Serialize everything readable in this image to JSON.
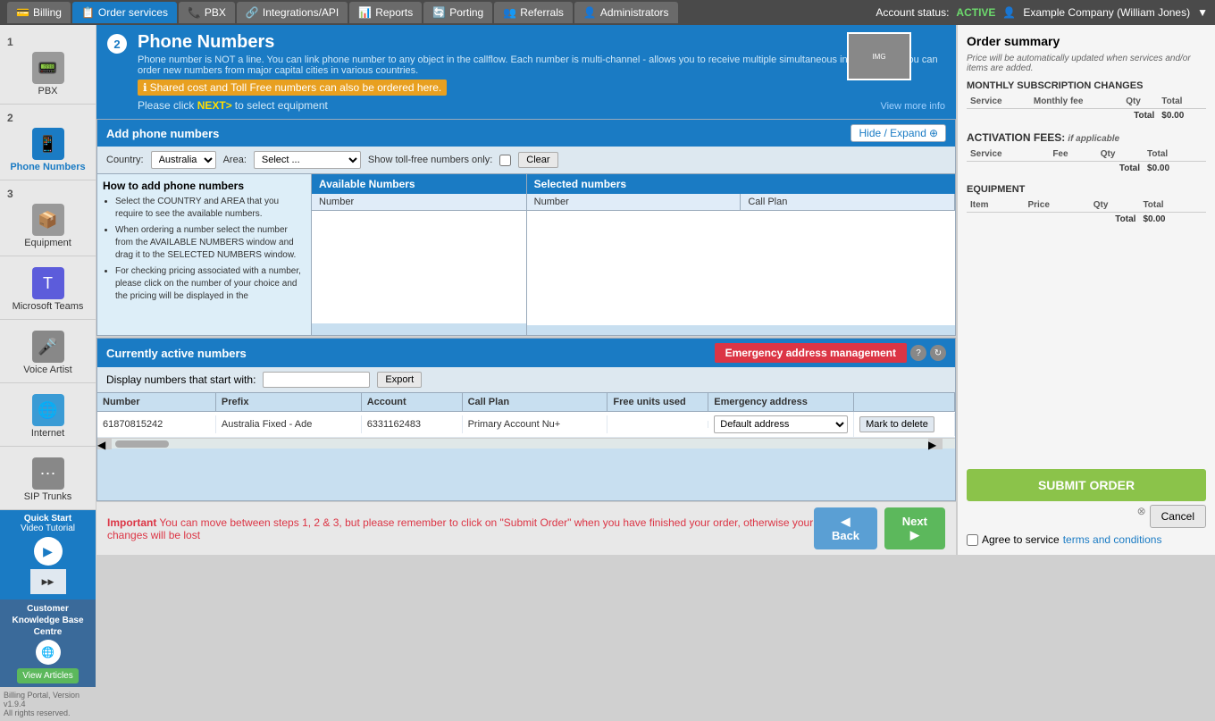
{
  "topNav": {
    "tabs": [
      {
        "id": "billing",
        "label": "Billing",
        "icon": "💳",
        "active": false
      },
      {
        "id": "order-services",
        "label": "Order services",
        "icon": "📋",
        "active": true
      },
      {
        "id": "pbx",
        "label": "PBX",
        "icon": "📞",
        "active": false
      },
      {
        "id": "integrations",
        "label": "Integrations/API",
        "icon": "🔗",
        "active": false
      },
      {
        "id": "reports",
        "label": "Reports",
        "icon": "📊",
        "active": false
      },
      {
        "id": "porting",
        "label": "Porting",
        "icon": "🔄",
        "active": false
      },
      {
        "id": "referrals",
        "label": "Referrals",
        "icon": "👥",
        "active": false
      },
      {
        "id": "administrators",
        "label": "Administrators",
        "icon": "👤",
        "active": false
      }
    ],
    "accountStatus": "Account status:",
    "accountStatusValue": "ACTIVE",
    "userName": "Example Company (William Jones)"
  },
  "sidebar": {
    "items": [
      {
        "step": "1",
        "label": "PBX",
        "icon": "📟",
        "active": false
      },
      {
        "step": "2",
        "label": "Phone Numbers",
        "icon": "📱",
        "active": true
      },
      {
        "step": "3",
        "label": "Equipment",
        "icon": "📦",
        "active": false
      }
    ],
    "microsoftTeams": {
      "label": "Microsoft Teams"
    },
    "voiceArtist": {
      "label": "Voice Artist"
    },
    "internet": {
      "label": "Internet"
    },
    "sipTrunks": {
      "label": "SIP Trunks"
    },
    "quickStart": {
      "line1": "Quick Start",
      "line2": "Video Tutorial"
    },
    "knowledge": {
      "title": "Customer Knowledge Base Centre",
      "btnLabel": "View Articles"
    },
    "version": "Billing Portal, Version v1.9.4\nAll rights reserved."
  },
  "phoneNumbers": {
    "stepBadge": "2",
    "title": "Phone Numbers",
    "description": "Phone number is NOT a line. You can link phone number to any object in the callflow. Each number is multi-channel - allows you to receive multiple simultaneous inbound calls. You can order new numbers from major capital cities in various countries.",
    "sharedCostNote": "Shared cost and Toll Free numbers can also be ordered here.",
    "nextInstruction": "Please click NEXT> to select equipment",
    "viewMoreInfo": "View more info"
  },
  "addNumbers": {
    "sectionTitle": "Add phone numbers",
    "hideExpandLabel": "Hide / Expand",
    "countryLabel": "Country:",
    "countryValue": "Australia",
    "areaLabel": "Area:",
    "areaPlaceholder": "Select ...",
    "tollFreeLabel": "Show toll-free numbers only:",
    "clearLabel": "Clear",
    "infoTitle": "How to add phone numbers",
    "instructions": [
      "Select the COUNTRY and AREA that you require to see the available numbers.",
      "When ordering a number select the number from the AVAILABLE NUMBERS window and drag it to the SELECTED NUMBERS window.",
      "For checking pricing associated with a number, please click on the number of your choice and the pricing will be displayed in the"
    ],
    "availableNumbersHeader": "Available Numbers",
    "numberColHeader": "Number",
    "selectedNumbersHeader": "Selected numbers",
    "selectedCols": [
      "Number",
      "Call Plan"
    ]
  },
  "activeNumbers": {
    "sectionTitle": "Currently active numbers",
    "displayLabel": "Display numbers that start with:",
    "exportLabel": "Export",
    "emergencyBtnLabel": "Emergency address management",
    "tableHeaders": [
      "Number",
      "Prefix",
      "Account",
      "Call Plan",
      "Free units used",
      "Emergency address"
    ],
    "rows": [
      {
        "number": "61870815242",
        "prefix": "Australia Fixed - Ade",
        "account": "6331162483",
        "callPlan": "Primary Account Nu+",
        "freeUnits": "",
        "emergencyAddress": "Default address",
        "action": "Mark to delete"
      }
    ]
  },
  "bottomBar": {
    "importantLabel": "Important",
    "importantText": "You can move between steps 1, 2 & 3, but please remember to click on \"Submit Order\" when you have finished your order, otherwise your changes will be lost",
    "backLabel": "◀  Back",
    "nextLabel": "Next  ▶"
  },
  "orderSummary": {
    "title": "Order summary",
    "autoUpdateNote": "Price will be automatically updated when services and/or items are added.",
    "monthlySection": {
      "title": "MONTHLY SUBSCRIPTION CHANGES",
      "columns": [
        "Service",
        "Monthly fee",
        "Qty",
        "Total"
      ],
      "total": "$0.00"
    },
    "activationSection": {
      "title": "ACTIVATION FEES:",
      "ifApplicable": "if applicable",
      "columns": [
        "Service",
        "Fee",
        "Qty",
        "Total"
      ],
      "total": "$0.00"
    },
    "equipmentSection": {
      "title": "EQUIPMENT",
      "columns": [
        "Item",
        "Price",
        "Qty",
        "Total"
      ],
      "total": "$0.00"
    },
    "submitLabel": "SUBMIT ORDER",
    "cancelLabel": "Cancel",
    "agreeText": "Agree to service",
    "termsLabel": "terms and conditions"
  }
}
